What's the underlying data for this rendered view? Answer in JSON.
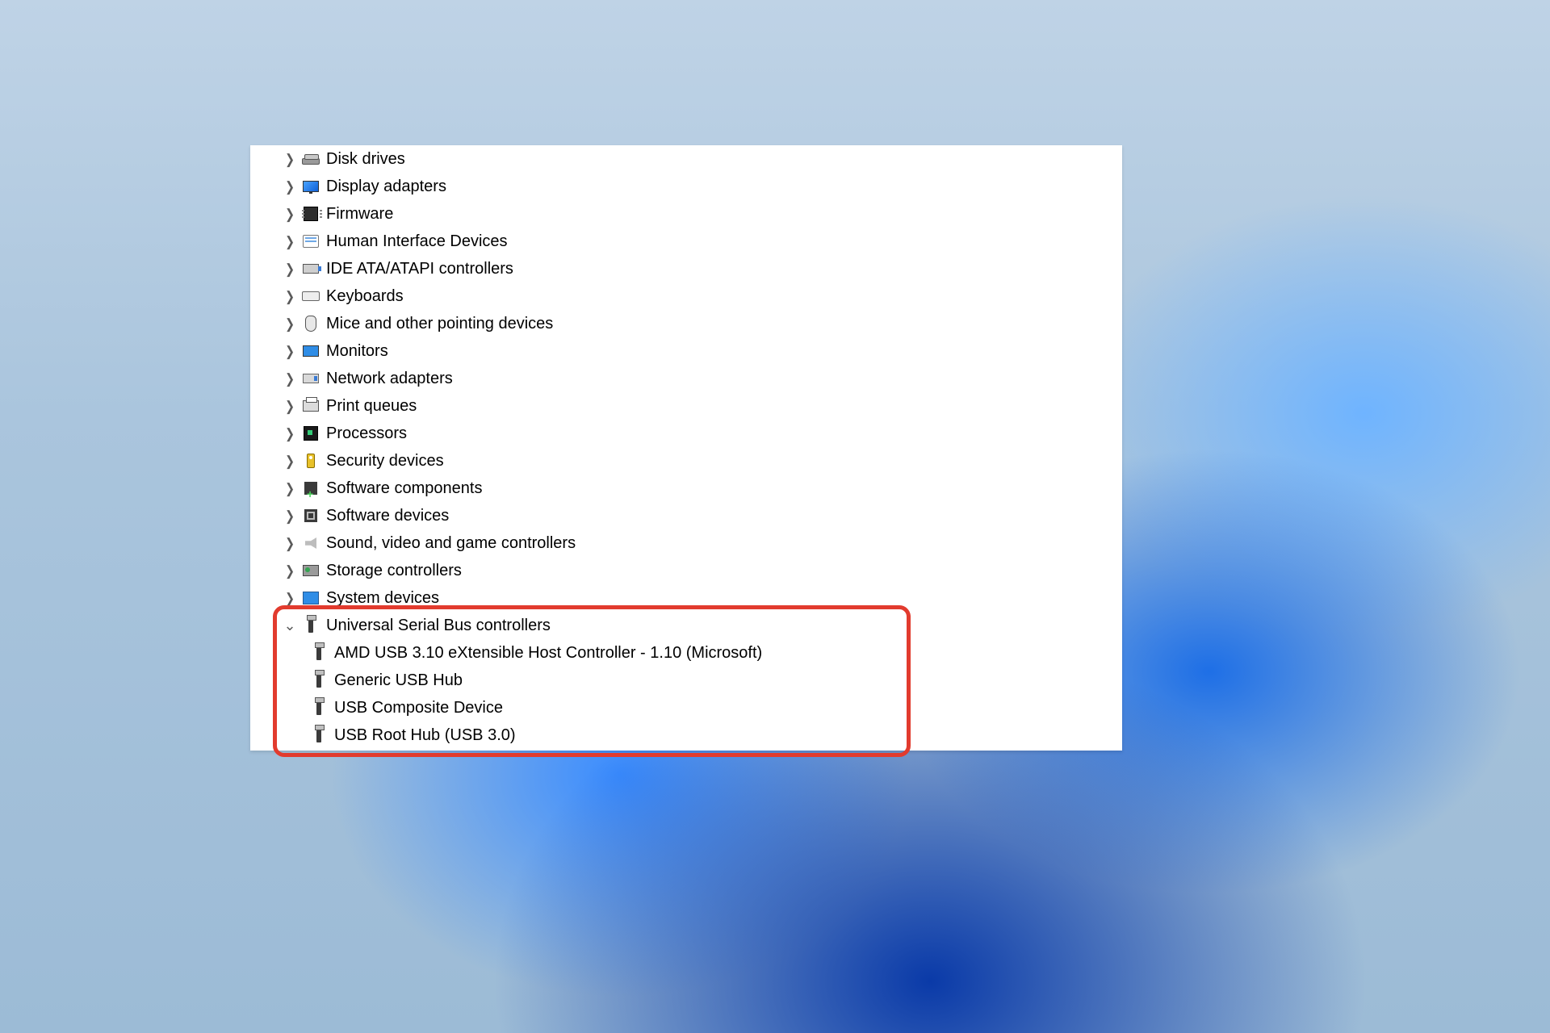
{
  "tree": {
    "categories": [
      {
        "id": "disk-drives",
        "label": "Disk drives",
        "icon": "disk-drive-icon",
        "expanded": false
      },
      {
        "id": "display-adapters",
        "label": "Display adapters",
        "icon": "display-adapter-icon",
        "expanded": false
      },
      {
        "id": "firmware",
        "label": "Firmware",
        "icon": "firmware-icon",
        "expanded": false
      },
      {
        "id": "human-interface-devices",
        "label": "Human Interface Devices",
        "icon": "hid-icon",
        "expanded": false
      },
      {
        "id": "ide-ata-atapi-controllers",
        "label": "IDE ATA/ATAPI controllers",
        "icon": "ide-icon",
        "expanded": false
      },
      {
        "id": "keyboards",
        "label": "Keyboards",
        "icon": "keyboard-icon",
        "expanded": false
      },
      {
        "id": "mice-and-other-pointing-devices",
        "label": "Mice and other pointing devices",
        "icon": "mouse-icon",
        "expanded": false
      },
      {
        "id": "monitors",
        "label": "Monitors",
        "icon": "monitor-icon",
        "expanded": false
      },
      {
        "id": "network-adapters",
        "label": "Network adapters",
        "icon": "network-adapter-icon",
        "expanded": false
      },
      {
        "id": "print-queues",
        "label": "Print queues",
        "icon": "printer-icon",
        "expanded": false
      },
      {
        "id": "processors",
        "label": "Processors",
        "icon": "processor-icon",
        "expanded": false
      },
      {
        "id": "security-devices",
        "label": "Security devices",
        "icon": "security-device-icon",
        "expanded": false
      },
      {
        "id": "software-components",
        "label": "Software components",
        "icon": "software-component-icon",
        "expanded": false
      },
      {
        "id": "software-devices",
        "label": "Software devices",
        "icon": "software-device-icon",
        "expanded": false
      },
      {
        "id": "sound-video-game-controllers",
        "label": "Sound, video and game controllers",
        "icon": "sound-icon",
        "expanded": false
      },
      {
        "id": "storage-controllers",
        "label": "Storage controllers",
        "icon": "storage-controller-icon",
        "expanded": false
      },
      {
        "id": "system-devices",
        "label": "System devices",
        "icon": "system-device-icon",
        "expanded": false
      },
      {
        "id": "universal-serial-bus-controllers",
        "label": "Universal Serial Bus controllers",
        "icon": "usb-icon",
        "expanded": true,
        "children": [
          {
            "id": "amd-usb-xhci",
            "label": "AMD USB 3.10 eXtensible Host Controller - 1.10 (Microsoft)",
            "icon": "usb-icon"
          },
          {
            "id": "generic-usb-hub",
            "label": "Generic USB Hub",
            "icon": "usb-icon"
          },
          {
            "id": "usb-composite-device",
            "label": "USB Composite Device",
            "icon": "usb-icon"
          },
          {
            "id": "usb-root-hub",
            "label": "USB Root Hub (USB 3.0)",
            "icon": "usb-icon"
          }
        ]
      }
    ]
  },
  "highlight_color": "#e23b2e"
}
